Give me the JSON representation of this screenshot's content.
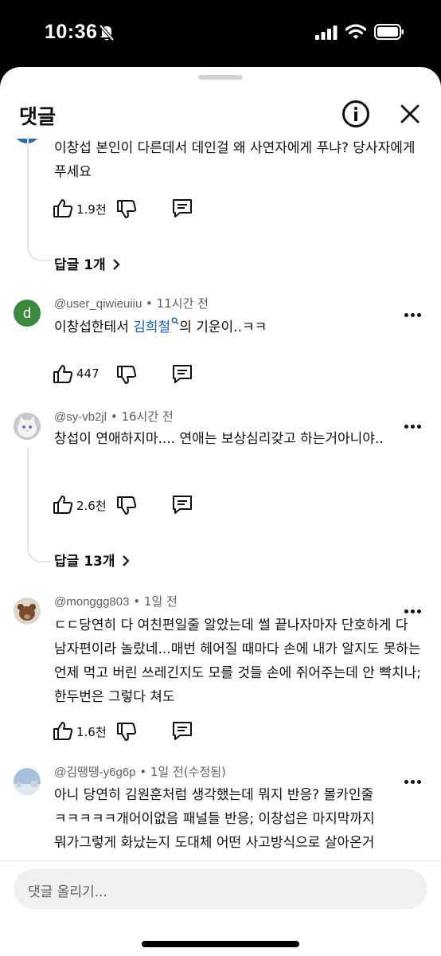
{
  "status": {
    "time": "10:36"
  },
  "sheet": {
    "title": "댓글"
  },
  "comments": [
    {
      "body": "이창섭 본인이 다른데서 데인걸 왜 사연자에게 푸냐? 당사자에게 푸세요",
      "likes": "1.9천",
      "replies_label": "답글 1개"
    },
    {
      "avatar_letter": "d",
      "handle": "@user_qiwieuiiu",
      "time": "11시간 전",
      "body_before": "이창섭한테서 ",
      "body_link": "김희철",
      "body_after": "의 기운이..ㅋㅋ",
      "likes": "447"
    },
    {
      "handle": "@sy-vb2jl",
      "time": "16시간 전",
      "body": "창섭이 연애하지마.... 연애는 보상심리갖고 하는거아니야..",
      "likes": "2.6천",
      "replies_label": "답글 13개"
    },
    {
      "handle": "@monggg803",
      "time": "1일 전",
      "body": "ㄷㄷ당연히 다 여친편일줄 알았는데 썰 끝나자마자 단호하게 다 남자편이라 놀랐네...매번 헤어질 때마다 손에 내가 알지도 못하는 언제 먹고 버린 쓰레긴지도 모를 것들 손에 쥐어주는데 안 빡치나; 한두번은 그렇다 쳐도",
      "likes": "1.6천"
    },
    {
      "handle": "@김땡땡-y6g6p",
      "time": "1일 전(수정됨)",
      "body": "아니 당연히 김원훈처럼 생각했는데 뭐지 반응? 몰카인줄 ㅋㅋㅋㅋㅋ개어이없음 패널들 반응; 이창섭은 마지막까지 뭐가그렇게 화났는지 도대체 어떤 사고방식으로 살아온거"
    }
  ],
  "composer": {
    "placeholder": "댓글 올리기..."
  },
  "colors": {
    "link": "#065fd4",
    "avatar_d": "#3a8a3e"
  }
}
